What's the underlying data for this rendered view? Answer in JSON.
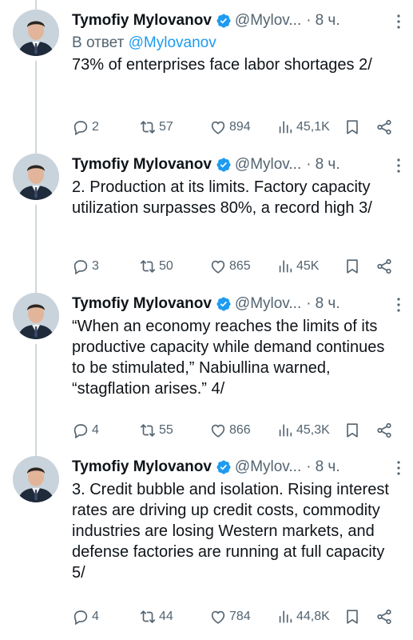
{
  "tweets": [
    {
      "author": "Tymofiy Mylovanov",
      "handle": "@Mylov...",
      "separator": "·",
      "time": "8 ч.",
      "reply_prefix": "В ответ",
      "reply_mention": "@Mylovanov",
      "text": "73% of enterprises face labor shortages 2/",
      "replies": "2",
      "retweets": "57",
      "likes": "894",
      "views": "45,1K"
    },
    {
      "author": "Tymofiy Mylovanov",
      "handle": "@Mylov...",
      "separator": "·",
      "time": "8 ч.",
      "text": "2. Production at its limits. Factory capacity utilization surpasses 80%, a record high 3/",
      "replies": "3",
      "retweets": "50",
      "likes": "865",
      "views": "45K"
    },
    {
      "author": "Tymofiy Mylovanov",
      "handle": "@Mylov...",
      "separator": "·",
      "time": "8 ч.",
      "text": "“When an economy reaches the limits of its productive capacity while demand continues to be stimulated,” Nabiullina warned, “stagflation arises.” 4/",
      "replies": "4",
      "retweets": "55",
      "likes": "866",
      "views": "45,3K"
    },
    {
      "author": "Tymofiy Mylovanov",
      "handle": "@Mylov...",
      "separator": "·",
      "time": "8 ч.",
      "text": "3. Credit bubble and isolation. Rising interest rates are driving up credit costs, commodity industries are losing Western markets, and defense factories are running at full capacity 5/",
      "replies": "4",
      "retweets": "44",
      "likes": "784",
      "views": "44,8K"
    }
  ],
  "icons": {
    "verified": "verified-badge-icon",
    "more": "more-dots-icon",
    "reply": "reply-bubble-icon",
    "retweet": "retweet-icon",
    "like": "heart-icon",
    "views": "views-chart-icon",
    "bookmark": "bookmark-icon",
    "share": "share-icon"
  },
  "colors": {
    "text": "#0f1419",
    "secondary": "#536471",
    "accent": "#1d9bf0",
    "thread_line": "#cfd9de"
  }
}
